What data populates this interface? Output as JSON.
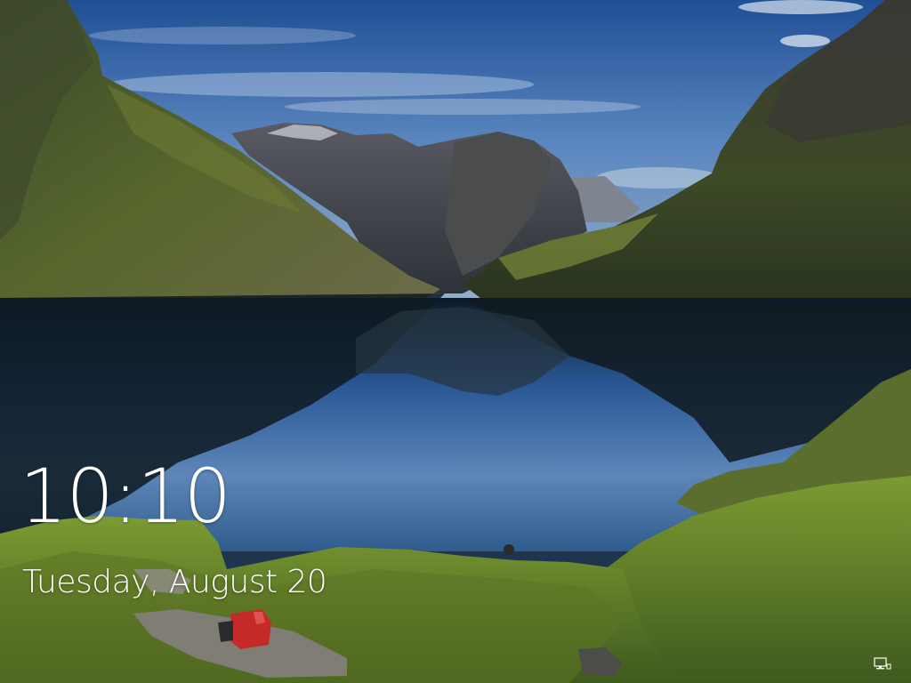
{
  "lockscreen": {
    "time": "10:10",
    "date": "Tuesday, August 20"
  },
  "status_icons": [
    {
      "icon": "network-icon"
    }
  ],
  "colors": {
    "text": "#ffffff",
    "sky": "#3a6ba8",
    "lake": "#2a5a9a",
    "grass": "#6f8a32",
    "backpack": "#c42a2a"
  }
}
